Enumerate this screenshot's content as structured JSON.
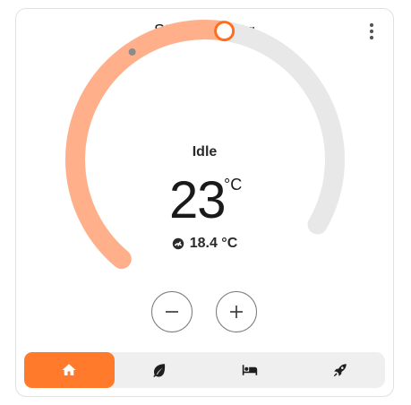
{
  "card": {
    "title": "Study Heating",
    "menu_icon": "dots-vertical-icon"
  },
  "thermostat": {
    "state": "Idle",
    "target_temperature": "23",
    "target_unit": "°C",
    "current_temperature": "18.4 °C",
    "current_icon": "thermometer-gauge-icon",
    "min": 7,
    "max": 35,
    "target_value": 23,
    "current_value": 18.4,
    "heat_color": "#ffb08a",
    "handle_color": "#ff6d1f",
    "track_color": "#e8e8e8"
  },
  "controls": {
    "decrease_icon": "minus-icon",
    "increase_icon": "plus-icon"
  },
  "modes": [
    {
      "name": "home",
      "icon": "home-icon",
      "active": true
    },
    {
      "name": "eco",
      "icon": "leaf-icon",
      "active": false
    },
    {
      "name": "sleep",
      "icon": "bed-icon",
      "active": false
    },
    {
      "name": "boost",
      "icon": "rocket-icon",
      "active": false
    }
  ],
  "colors": {
    "accent": "#ff7a2a",
    "mode_bar": "#efefef"
  }
}
